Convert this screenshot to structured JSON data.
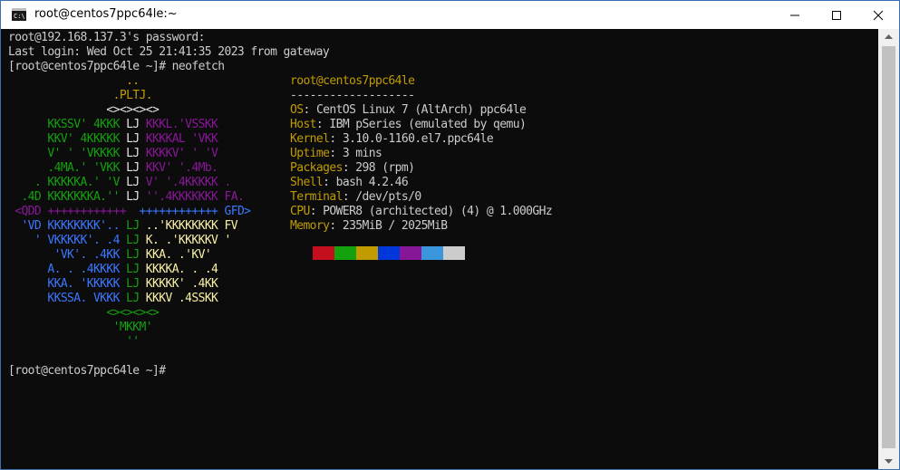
{
  "window": {
    "title": "root@centos7ppc64le:~"
  },
  "terminal": {
    "pre_lines": [
      "root@192.168.137.3's password:",
      "Last login: Wed Oct 25 21:41:35 2023 from gateway",
      "[root@centos7ppc64le ~]# neofetch"
    ],
    "logo": [
      [
        {
          "t": "                  ..",
          "c": "y"
        }
      ],
      [
        {
          "t": "                .PLTJ.",
          "c": "y"
        }
      ],
      [
        {
          "t": "               <><><><>",
          "c": "w"
        }
      ],
      [
        {
          "t": "      KKSSV' 4KKK ",
          "c": "g"
        },
        {
          "t": "LJ",
          "c": "w"
        },
        {
          "t": " KKKL.'VSSKK",
          "c": "m"
        }
      ],
      [
        {
          "t": "      KKV' 4KKKKK ",
          "c": "g"
        },
        {
          "t": "LJ",
          "c": "w"
        },
        {
          "t": " KKKKAL 'VKK",
          "c": "m"
        }
      ],
      [
        {
          "t": "      V' ' 'VKKKK ",
          "c": "g"
        },
        {
          "t": "LJ",
          "c": "w"
        },
        {
          "t": " KKKKV' ' 'V",
          "c": "m"
        }
      ],
      [
        {
          "t": "      .4MA.' 'VKK ",
          "c": "g"
        },
        {
          "t": "LJ",
          "c": "w"
        },
        {
          "t": " KKV' '.4Mb.",
          "c": "m"
        }
      ],
      [
        {
          "t": "    . KKKKKA.' 'V ",
          "c": "g"
        },
        {
          "t": "LJ",
          "c": "w"
        },
        {
          "t": " V' '.4KKKKK .",
          "c": "m"
        }
      ],
      [
        {
          "t": "  .4D KKKKKKKA.'' ",
          "c": "g"
        },
        {
          "t": "LJ",
          "c": "w"
        },
        {
          "t": " ''.4KKKKKKK FA.",
          "c": "m"
        }
      ],
      [
        {
          "t": " <QDD ++++++++++++  ",
          "c": "m"
        },
        {
          "t": "++++++++++++ GFD>",
          "c": "b"
        }
      ],
      [
        {
          "t": "  'VD KKKKKKKK'.. ",
          "c": "b"
        },
        {
          "t": "LJ",
          "c": "g"
        },
        {
          "t": " ..'KKKKKKKK FV",
          "c": "yl"
        }
      ],
      [
        {
          "t": "    ' VKKKKK'. .4 ",
          "c": "b"
        },
        {
          "t": "LJ",
          "c": "g"
        },
        {
          "t": " K. .'KKKKKV '",
          "c": "yl"
        }
      ],
      [
        {
          "t": "       'VK'. .4KK ",
          "c": "b"
        },
        {
          "t": "LJ",
          "c": "g"
        },
        {
          "t": " KKA. .'KV'",
          "c": "yl"
        }
      ],
      [
        {
          "t": "      A. . .4KKKK ",
          "c": "b"
        },
        {
          "t": "LJ",
          "c": "g"
        },
        {
          "t": " KKKKA. . .4",
          "c": "yl"
        }
      ],
      [
        {
          "t": "      KKA. 'KKKKK ",
          "c": "b"
        },
        {
          "t": "LJ",
          "c": "g"
        },
        {
          "t": " KKKKK' .4KK",
          "c": "yl"
        }
      ],
      [
        {
          "t": "      KKSSA. VKKK ",
          "c": "b"
        },
        {
          "t": "LJ",
          "c": "g"
        },
        {
          "t": " KKKV .4SSKK",
          "c": "yl"
        }
      ],
      [
        {
          "t": "               <><><><>",
          "c": "g"
        }
      ],
      [
        {
          "t": "                'MKKM'",
          "c": "g"
        }
      ],
      [
        {
          "t": "                  ''",
          "c": "g"
        }
      ]
    ],
    "header": "root@centos7ppc64le",
    "separator": "-------------------",
    "info": [
      {
        "key": "OS",
        "value": "CentOS Linux 7 (AltArch) ppc64le"
      },
      {
        "key": "Host",
        "value": "IBM pSeries (emulated by qemu)"
      },
      {
        "key": "Kernel",
        "value": "3.10.0-1160.el7.ppc64le"
      },
      {
        "key": "Uptime",
        "value": "3 mins"
      },
      {
        "key": "Packages",
        "value": "298 (rpm)"
      },
      {
        "key": "Shell",
        "value": "bash 4.2.46"
      },
      {
        "key": "Terminal",
        "value": "/dev/pts/0"
      },
      {
        "key": "CPU",
        "value": "POWER8 (architected) (4) @ 1.000GHz"
      },
      {
        "key": "Memory",
        "value": "235MiB / 2025MiB"
      }
    ],
    "palette": [
      "#c50f1f",
      "#13a10e",
      "#c19c00",
      "#0037da",
      "#881798",
      "#3a96dd",
      "#cccccc"
    ],
    "prompt": "[root@centos7ppc64le ~]#"
  }
}
